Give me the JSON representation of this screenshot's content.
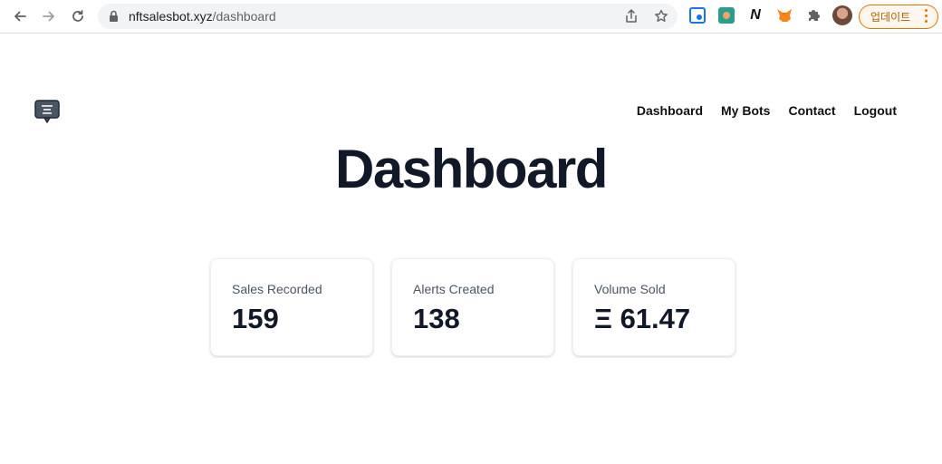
{
  "browser": {
    "url_host": "nftsalesbot.xyz",
    "url_path": "/dashboard",
    "update_label": "업데이트"
  },
  "nav": {
    "items": [
      {
        "label": "Dashboard"
      },
      {
        "label": "My Bots"
      },
      {
        "label": "Contact"
      },
      {
        "label": "Logout"
      }
    ]
  },
  "page": {
    "title": "Dashboard"
  },
  "stats": [
    {
      "label": "Sales Recorded",
      "value": "159"
    },
    {
      "label": "Alerts Created",
      "value": "138"
    },
    {
      "label": "Volume Sold",
      "value": "Ξ 61.47"
    }
  ],
  "colors": {
    "title": "#111827",
    "update_accent": "#e37400"
  }
}
